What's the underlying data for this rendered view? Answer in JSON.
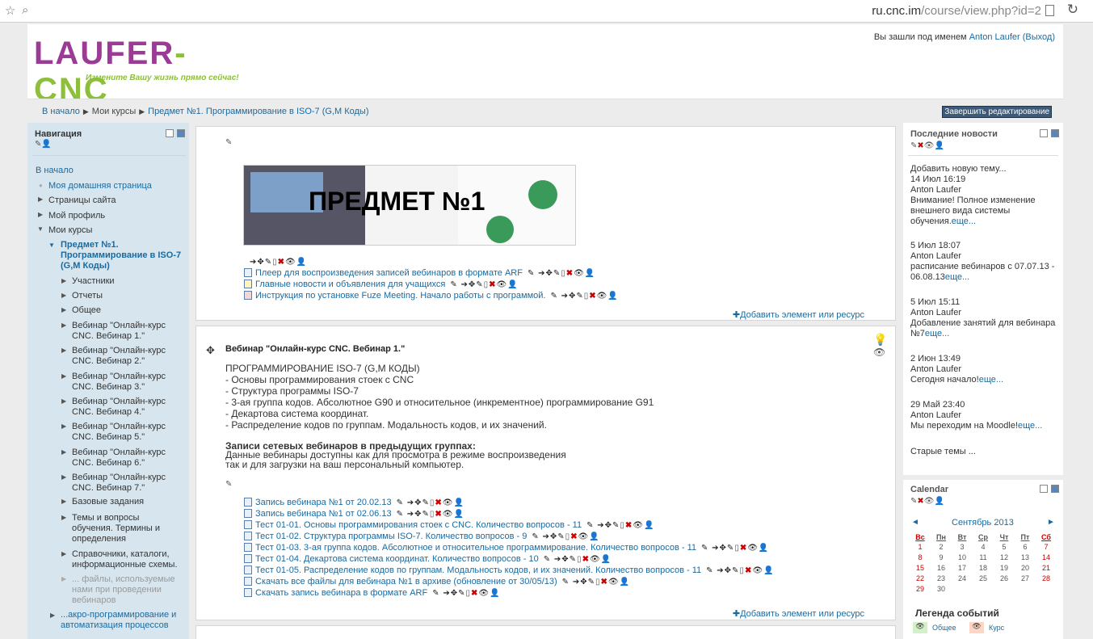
{
  "browser": {
    "url_host": "ru.cnc.im",
    "url_path": "/course/view.php?id=2"
  },
  "header": {
    "logo_text_a": "LAUFER",
    "logo_text_b": "-CNC",
    "logo_slogan": "Измените Вашу жизнь прямо сейчас!",
    "login_prefix": "Вы зашли под именем",
    "login_user": "Anton Laufer",
    "logout": "(Выход)"
  },
  "breadcrumb": {
    "home": "В начало",
    "my_courses": "Мои курсы",
    "course": "Предмет №1. Программирование в ISO-7 (G,M Коды)",
    "sep": "▶"
  },
  "edit_button": "Завершить редактирование",
  "navigation": {
    "title": "Навигация",
    "home": "В начало",
    "my_home": "Моя домашняя страница",
    "site_pages": "Страницы сайта",
    "my_profile": "Мой профиль",
    "my_courses": "Мои курсы",
    "current_course": "Предмет №1. Программирование в ISO-7 (G,M Коды)",
    "items": [
      "Участники",
      "Отчеты",
      "Общее",
      "Вебинар \"Онлайн-курс CNC. Вебинар 1.\"",
      "Вебинар \"Онлайн-курс CNC. Вебинар 2.\"",
      "Вебинар \"Онлайн-курс CNC. Вебинар 3.\"",
      "Вебинар \"Онлайн-курс CNC. Вебинар 4.\"",
      "Вебинар \"Онлайн-курс CNC. Вебинар 5.\"",
      "Вебинар \"Онлайн-курс CNC. Вебинар 6.\"",
      "Вебинар \"Онлайн-курс CNC. Вебинар 7.\"",
      "Базовые задания",
      "Темы и вопросы обучения. Термины и определения",
      "Справочники, каталоги, информационные схемы.",
      "... файлы, используемые нами при проведении вебинаров"
    ],
    "last_item": "...акро-программирование и автоматизация процессов"
  },
  "section0": {
    "banner_title": "ПРЕДМЕТ №1",
    "resources": [
      "Плеер для воспроизведения записей вебинаров в формате ARF",
      "Главные новости и объявления для учащихся",
      "Инструкция по установке Fuze Meeting. Начало работы с программой."
    ],
    "add_resource": "Добавить элемент или ресурс"
  },
  "section1": {
    "title": "Вебинар \"Онлайн-курс CNC. Вебинар 1.\"",
    "summary": [
      "ПРОГРАММИРОВАНИЕ ISO-7 (G,M КОДЫ)",
      "- Основы программирования стоек с CNC",
      "- Структура программы ISO-7",
      "- 3-ая группа кодов. Абсолютное G90 и относительное (инкрементное) программирование G91",
      "- Декартова система координат.",
      "- Распределение кодов по группам. Модальность кодов, и их значений."
    ],
    "records_title": "Записи сетевых вебинаров в предыдущих группах:",
    "records_text_1": "Данные вебинары доступны как для просмотра в режиме воспроизведения",
    "records_text_2": "так и для загрузки на ваш персональный компьютер.",
    "resources": [
      "Запись вебинара №1 от 20.02.13",
      "Запись вебинара №1 от 02.06.13",
      "Тест 01-01. Основы программирования стоек с CNC. Количество вопросов - 11",
      "Тест 01-02. Структура программы ISO-7. Количество вопросов - 9",
      "Тест 01-03. 3-ая группа кодов. Абсолютное и относительное программирование. Количество вопросов - 11",
      "Тест 01-04. Декартова система координат. Количество вопросов - 10",
      "Тест 01-05. Распределение кодов по группам. Модальность кодов, и их значений. Количество вопросов - 11",
      "Скачать все файлы для вебинара №1 в архиве (обновление от 30/05/13)",
      "Скачать запись вебинара в формате ARF"
    ],
    "add_resource": "Добавить элемент или ресурс"
  },
  "news": {
    "title": "Последние новости",
    "add_topic": "Добавить новую тему...",
    "more": "еще...",
    "old_topics": "Старые темы ...",
    "items": [
      {
        "date": "14 Июл 16:19",
        "author": "Anton Laufer",
        "text": "Внимание! Полное изменение внешнего вида системы обучения."
      },
      {
        "date": "5 Июл 18:07",
        "author": "Anton Laufer",
        "text": "расписание вебинаров с 07.07.13 - 06.08.13"
      },
      {
        "date": "5 Июл 15:11",
        "author": "Anton Laufer",
        "text": "Добавление занятий для вебинара №7"
      },
      {
        "date": "2 Июн 13:49",
        "author": "Anton Laufer",
        "text": "Сегодня начало!"
      },
      {
        "date": "29 Май 23:40",
        "author": "Anton Laufer",
        "text": "Мы переходим на Moodle!"
      }
    ]
  },
  "calendar": {
    "title": "Calendar",
    "month": "Сентябрь 2013",
    "prev": "◄",
    "next": "►",
    "days": [
      "Вс",
      "Пн",
      "Вт",
      "Ср",
      "Чт",
      "Пт",
      "Сб"
    ],
    "weeks": [
      [
        "1",
        "2",
        "3",
        "4",
        "5",
        "6",
        "7"
      ],
      [
        "8",
        "9",
        "10",
        "11",
        "12",
        "13",
        "14"
      ],
      [
        "15",
        "16",
        "17",
        "18",
        "19",
        "20",
        "21"
      ],
      [
        "22",
        "23",
        "24",
        "25",
        "26",
        "27",
        "28"
      ],
      [
        "29",
        "30",
        "",
        "",
        "",
        "",
        ""
      ]
    ],
    "legend_title": "Легенда событий",
    "legend_general": "Общее",
    "legend_course": "Курс"
  }
}
